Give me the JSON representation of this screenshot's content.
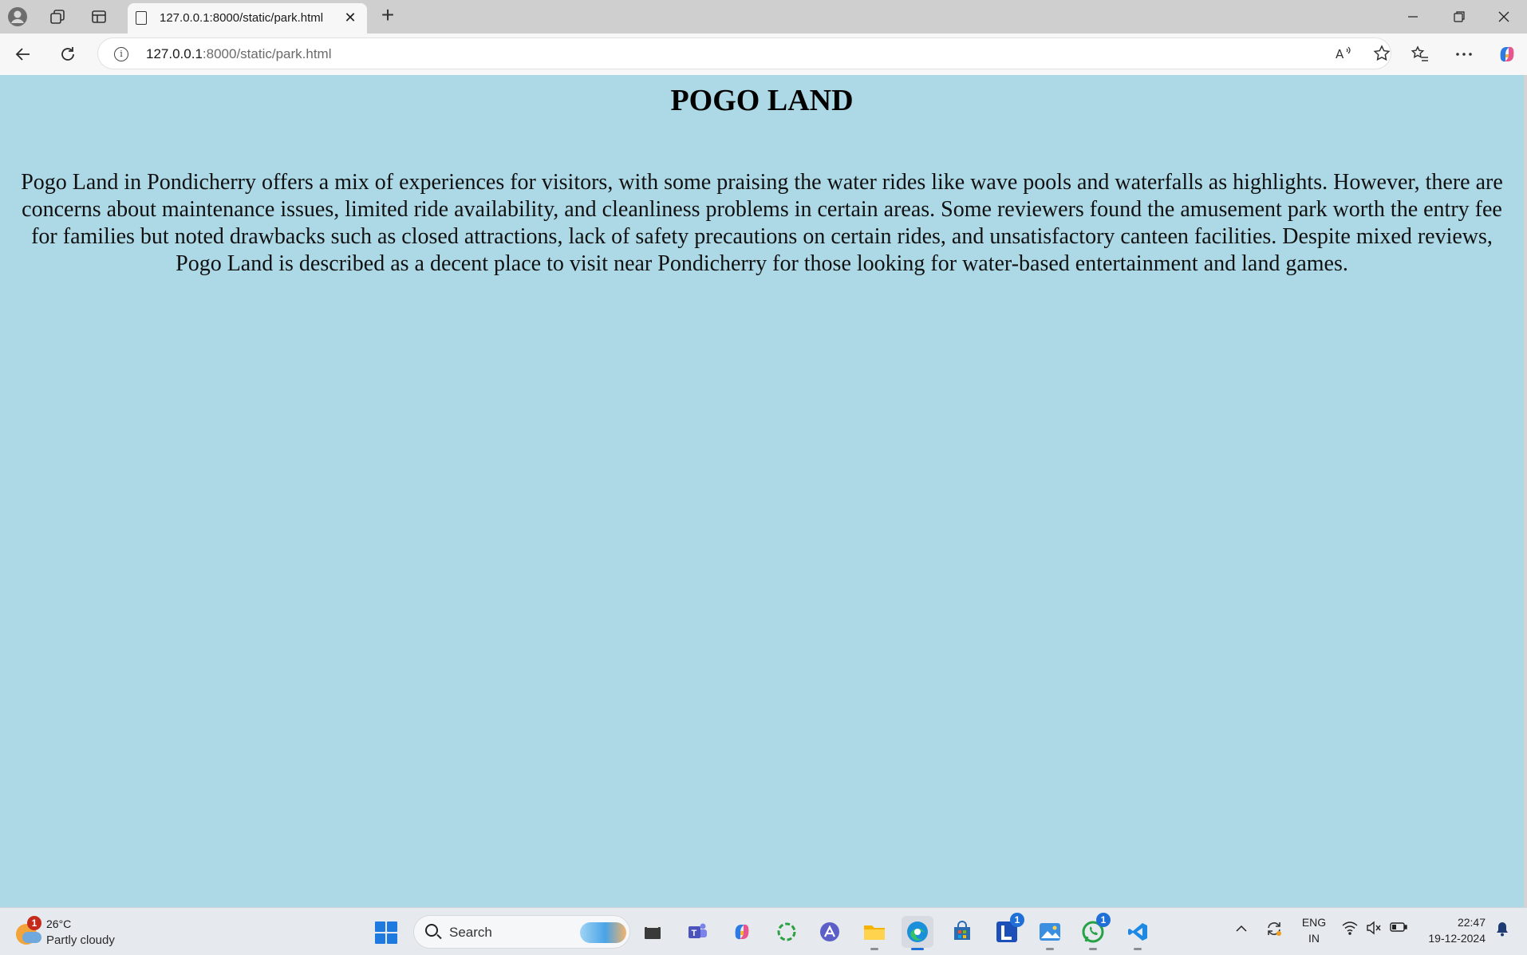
{
  "browser": {
    "tab_title": "127.0.0.1:8000/static/park.html",
    "url_host": "127.0.0.1",
    "url_rest": ":8000/static/park.html"
  },
  "page": {
    "heading": "POGO LAND",
    "body": "Pogo Land in Pondicherry offers a mix of experiences for visitors, with some praising the water rides like wave pools and waterfalls as highlights. However, there are concerns about maintenance issues, limited ride availability, and cleanliness problems in certain areas. Some reviewers found the amusement park worth the entry fee for families but noted drawbacks such as closed attractions, lack of safety precautions on certain rides, and unsatisfactory canteen facilities. Despite mixed reviews, Pogo Land is described as a decent place to visit near Pondicherry for those looking for water-based entertainment and land games.",
    "background": "#add8e6"
  },
  "taskbar": {
    "weather_badge": "1",
    "weather_temp": "26°C",
    "weather_condition": "Partly cloudy",
    "search_label": "Search",
    "apps": [
      {
        "name": "file-explorer-alt-icon"
      },
      {
        "name": "teams-icon"
      },
      {
        "name": "copilot-icon"
      },
      {
        "name": "refresh-app-icon"
      },
      {
        "name": "arc-icon"
      },
      {
        "name": "file-explorer-icon"
      },
      {
        "name": "edge-icon"
      },
      {
        "name": "store-icon"
      },
      {
        "name": "l-app-icon",
        "letter": "L",
        "badge": "1"
      },
      {
        "name": "photos-icon"
      },
      {
        "name": "whatsapp-icon",
        "badge": "1"
      },
      {
        "name": "vscode-icon"
      }
    ],
    "lang_line1": "ENG",
    "lang_line2": "IN",
    "time": "22:47",
    "date": "19-12-2024"
  }
}
